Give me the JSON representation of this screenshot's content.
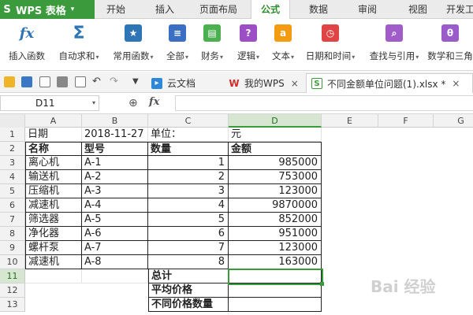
{
  "app": {
    "logo": "S",
    "title": "WPS 表格"
  },
  "menu_tabs": [
    {
      "label": "开始",
      "active": false
    },
    {
      "label": "插入",
      "active": false
    },
    {
      "label": "页面布局",
      "active": false
    },
    {
      "label": "公式",
      "active": true
    },
    {
      "label": "数据",
      "active": false
    },
    {
      "label": "审阅",
      "active": false
    },
    {
      "label": "视图",
      "active": false
    },
    {
      "label": "开发工",
      "active": false
    }
  ],
  "ribbon": [
    {
      "label": "插入函数",
      "icon": "fx-icon",
      "color": "#2e75b6"
    },
    {
      "label": "自动求和",
      "icon": "sigma-icon",
      "color": "#2e75b6"
    },
    {
      "label": "常用函数",
      "icon": "star-function-icon",
      "color": "#2e75b6"
    },
    {
      "label": "全部",
      "icon": "book-icon",
      "color": "#3a6fc4"
    },
    {
      "label": "财务",
      "icon": "finance-icon",
      "color": "#4caf50"
    },
    {
      "label": "逻辑",
      "icon": "question-icon",
      "color": "#9c4fc4"
    },
    {
      "label": "文本",
      "icon": "text-a-icon",
      "color": "#f39c12"
    },
    {
      "label": "日期和时间",
      "icon": "clock-icon",
      "color": "#e04444"
    },
    {
      "label": "查找与引用",
      "icon": "magnifier-icon",
      "color": "#a05cc8"
    },
    {
      "label": "数学和三角",
      "icon": "theta-icon",
      "color": "#9a5cc8"
    }
  ],
  "doc_tabs": [
    {
      "label": "云文档",
      "close": ""
    },
    {
      "label": "我的WPS",
      "close": "×"
    },
    {
      "label": "不同金额单位问题(1).xlsx *",
      "close": "×"
    }
  ],
  "formula_bar": {
    "cell_ref": "D11",
    "fx": "fx"
  },
  "columns": [
    "A",
    "B",
    "C",
    "D",
    "E",
    "F",
    "G"
  ],
  "rows": [
    "1",
    "2",
    "3",
    "4",
    "5",
    "6",
    "7",
    "8",
    "9",
    "10",
    "11",
    "12",
    "13"
  ],
  "sheet": {
    "r1": {
      "a": "日期",
      "b": "2018-11-27",
      "c": "单位：",
      "d": "元"
    },
    "r2": {
      "a": "名称",
      "b": "型号",
      "c": "数量",
      "d": "金额"
    },
    "data": [
      {
        "name": "离心机",
        "model": "A-1",
        "qty": "1",
        "amount": "985000"
      },
      {
        "name": "输送机",
        "model": "A-2",
        "qty": "2",
        "amount": "753000"
      },
      {
        "name": "压缩机",
        "model": "A-3",
        "qty": "3",
        "amount": "123000"
      },
      {
        "name": "减速机",
        "model": "A-4",
        "qty": "4",
        "amount": "9870000"
      },
      {
        "name": "筛选器",
        "model": "A-5",
        "qty": "5",
        "amount": "852000"
      },
      {
        "name": "净化器",
        "model": "A-6",
        "qty": "6",
        "amount": "951000"
      },
      {
        "name": "螺杆泵",
        "model": "A-7",
        "qty": "7",
        "amount": "123000"
      },
      {
        "name": "减速机",
        "model": "A-8",
        "qty": "8",
        "amount": "163000"
      }
    ],
    "summary": [
      "总计",
      "平均价格",
      "不同价格数量"
    ]
  },
  "watermark": "Bai 经验",
  "colors": {
    "brand": "#3b9a3c",
    "active_tab_text": "#2d8a2f"
  }
}
